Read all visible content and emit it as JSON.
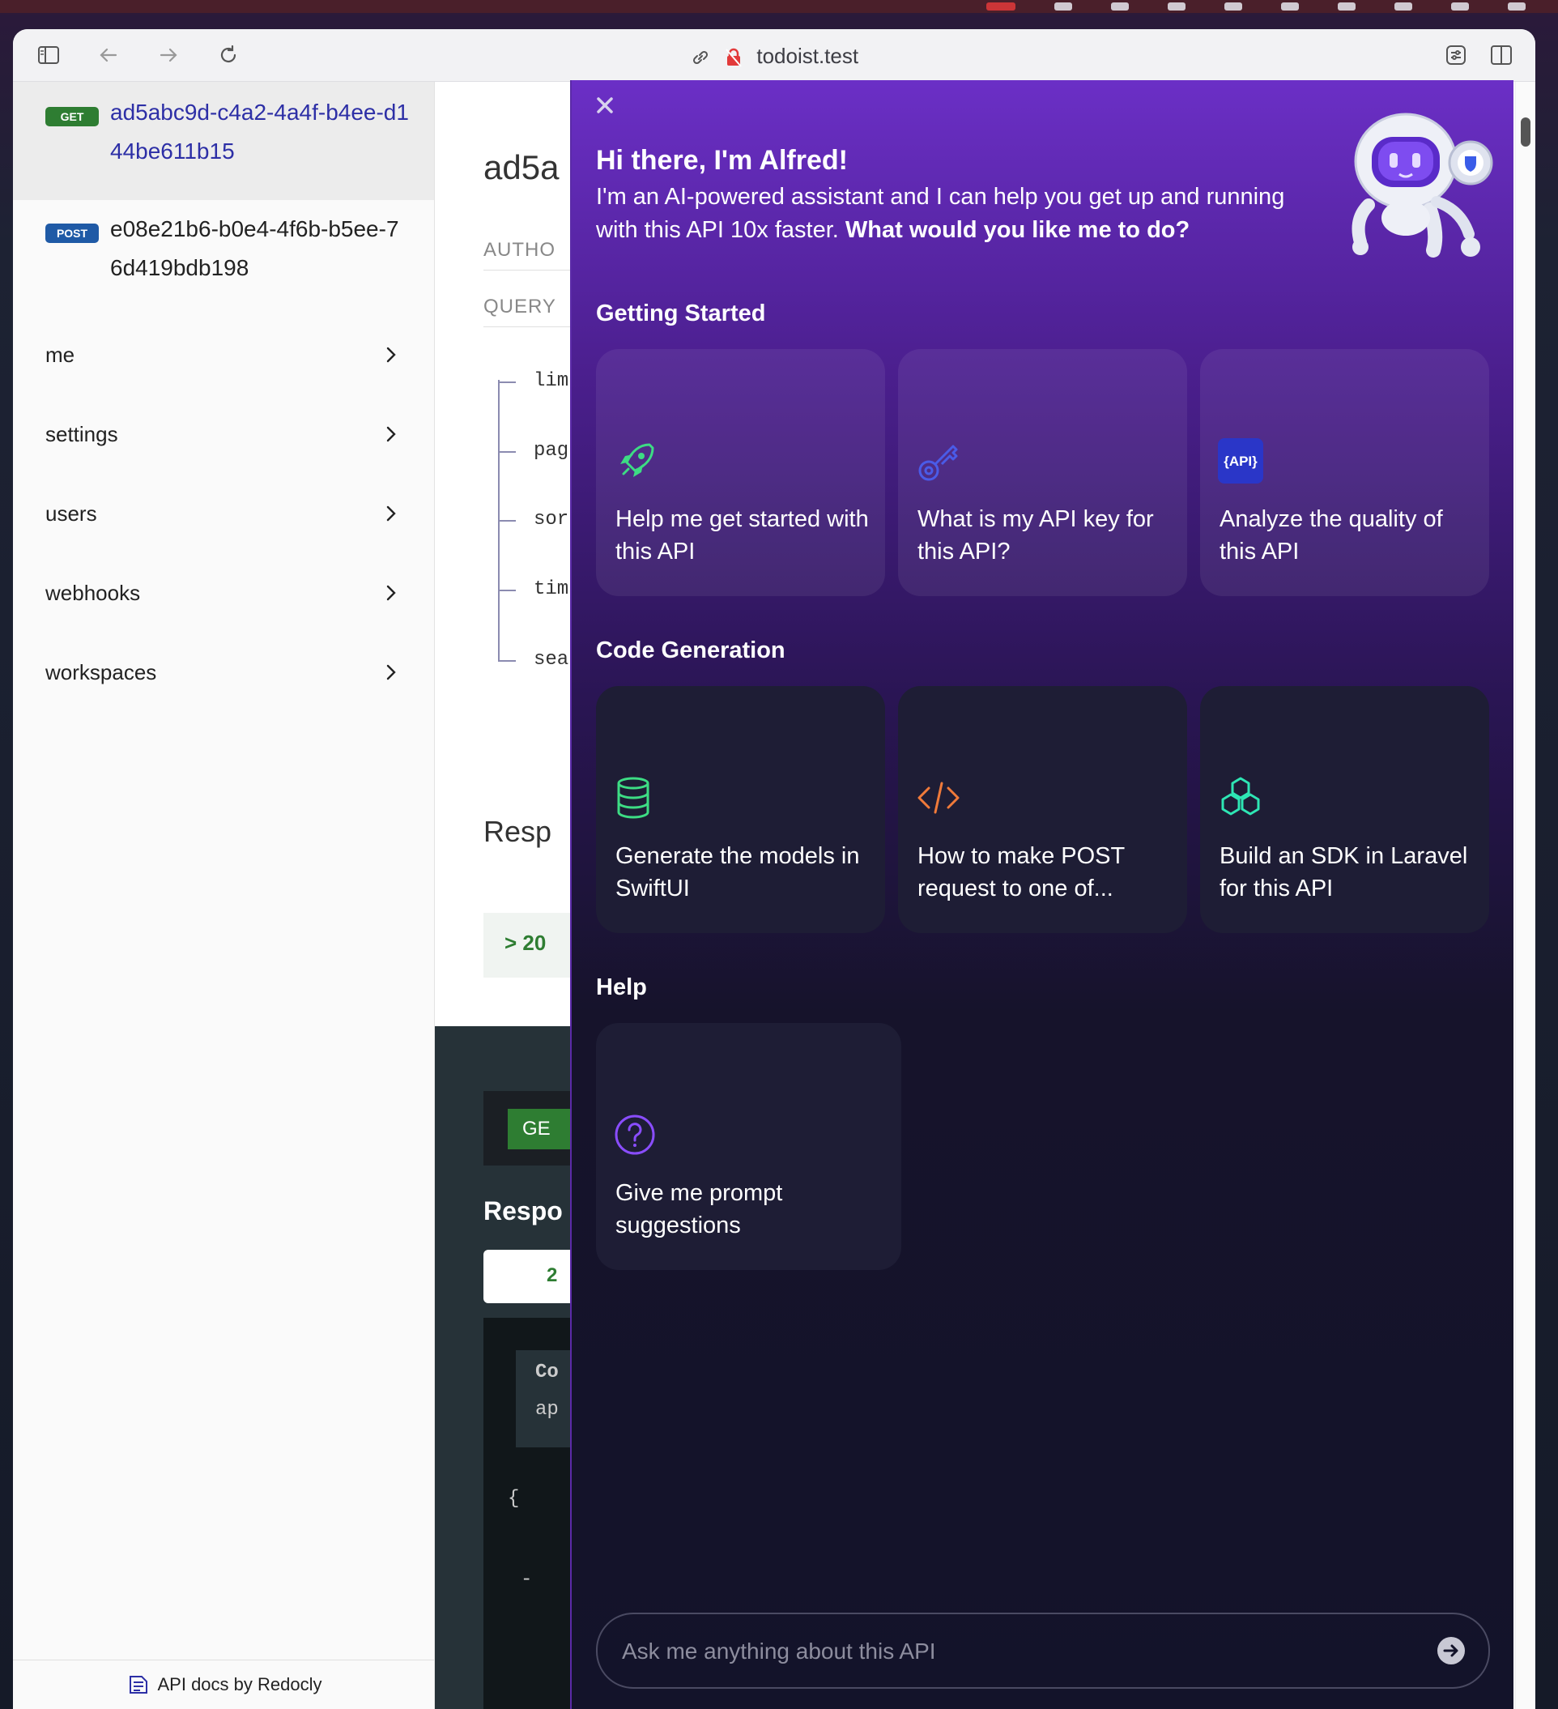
{
  "browser": {
    "url": "todoist.test"
  },
  "sidebar": {
    "endpoints": [
      {
        "method": "GET",
        "path": "ad5abc9d-c4a2-4a4f-b4ee-d144be611b15",
        "color": "#2e7d32"
      },
      {
        "method": "POST",
        "path": "e08e21b6-b0e4-4f6b-b5ee-76d419bdb198",
        "color": "#1f5aa6"
      }
    ],
    "groups": [
      "me",
      "settings",
      "users",
      "webhooks",
      "workspaces"
    ],
    "footer": "API docs by Redocly"
  },
  "middle": {
    "title": "ad5a",
    "auth_label": "AUTHO",
    "query_label": "QUERY",
    "params": [
      "lim",
      "pag",
      "sor",
      "tim",
      "sea"
    ],
    "responses_title": "Resp",
    "response_code": "20",
    "get_label": "GE",
    "dark_responses": "Respo",
    "tab_code": "2",
    "code_lines": [
      "Co",
      "ap",
      "{",
      "-",
      "-"
    ]
  },
  "assistant": {
    "greeting": "Hi there, I'm Alfred!",
    "intro": "I'm an AI-powered assistant and I can help you get up and running with this API 10x faster.",
    "intro_bold": "What would you like me to do?",
    "sections": {
      "getting_started": "Getting Started",
      "code_generation": "Code Generation",
      "help": "Help"
    },
    "cards": {
      "get_started": "Help me get started with this API",
      "api_key": "What is my API key for this API?",
      "analyze": "Analyze the quality of this API",
      "models": "Generate the models in SwiftUI",
      "post": "How to make POST request to one of...",
      "sdk": "Build an SDK in Laravel for this API",
      "prompts": "Give me prompt suggestions"
    },
    "api_badge": "{API}",
    "input_placeholder": "Ask me anything about this API",
    "icons": [
      "rocket-icon",
      "key-icon",
      "api-badge-icon",
      "database-icon",
      "code-icon",
      "cubes-icon",
      "question-icon"
    ],
    "colors": {
      "accent": "#6b2fc6",
      "rocket": "#3ddc84",
      "key": "#4a5be8",
      "code": "#f07a3a",
      "cubes": "#2ee6b4",
      "question": "#8a4dff"
    }
  }
}
